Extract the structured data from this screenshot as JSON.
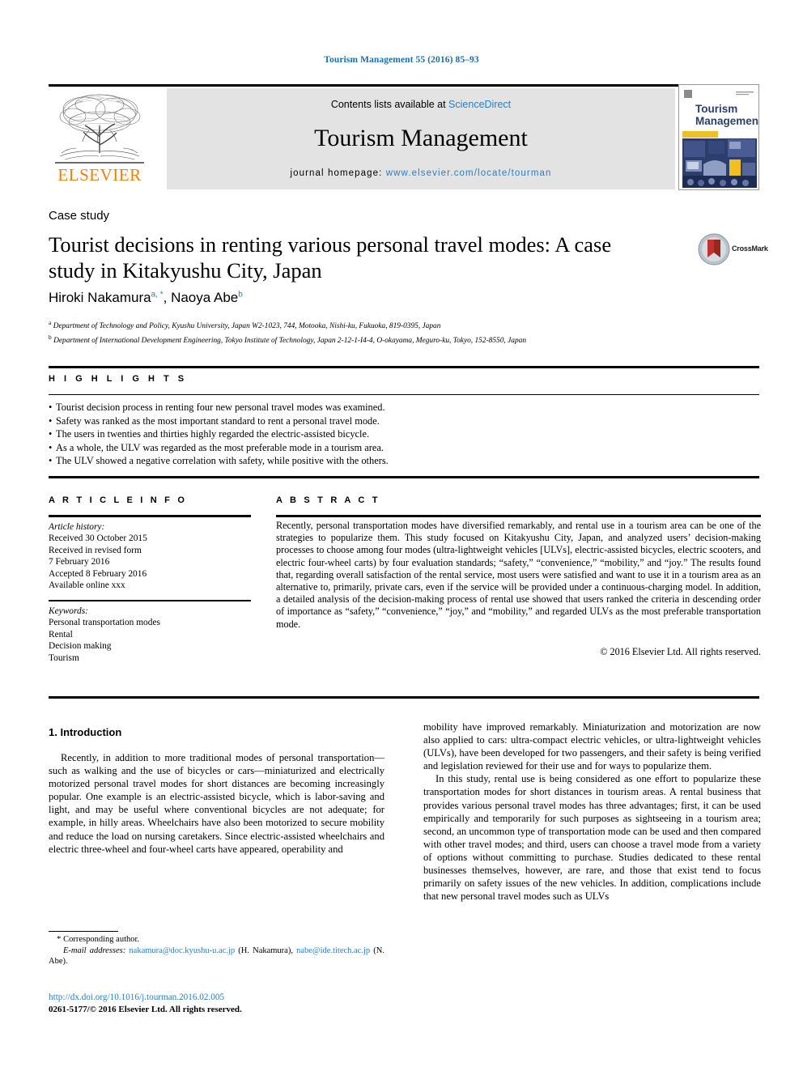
{
  "running_head": "Tourism Management 55 (2016) 85–93",
  "masthead": {
    "contents_prefix": "Contents lists available at ",
    "sciencedirect": "ScienceDirect",
    "journal_name": "Tourism Management",
    "homepage_label": "journal homepage: ",
    "homepage_url": "www.elsevier.com/locate/tourman",
    "publisher_logo_text": "ELSEVIER",
    "cover_title_line1": "Tourism",
    "cover_title_line2": "Management"
  },
  "colors": {
    "link": "#2a7fc0",
    "running_head": "#1d6fa5",
    "elsevier_orange": "#f08000",
    "band_gray": "#e3e3e3",
    "cover_navy": "#2c3e6b",
    "cover_yellow": "#f0c020"
  },
  "article": {
    "type_label": "Case study",
    "title": "Tourist decisions in renting various personal travel modes: A case study in Kitakyushu City, Japan",
    "authors_html": "Hiroki Nakamura, Naoya Abe",
    "author1_name": "Hiroki Nakamura",
    "author1_marks": "a, *",
    "author2_name": "Naoya Abe",
    "author2_marks": "b",
    "affiliation_a_mark": "a",
    "affiliation_a": "Department of Technology and Policy, Kyushu University, Japan W2-1023, 744, Motooka, Nishi-ku, Fukuoka, 819-0395, Japan",
    "affiliation_b_mark": "b",
    "affiliation_b": "Department of International Development Engineering, Tokyo Institute of Technology, Japan 2-12-1-I4-4, O-okayama, Meguro-ku, Tokyo, 152-8550, Japan",
    "crossmark_label": "CrossMark"
  },
  "highlights": {
    "heading": "H I G H L I G H T S",
    "items": [
      "Tourist decision process in renting four new personal travel modes was examined.",
      "Safety was ranked as the most important standard to rent a personal travel mode.",
      "The users in twenties and thirties highly regarded the electric-assisted bicycle.",
      "As a whole, the ULV was regarded as the most preferable mode in a tourism area.",
      "The ULV showed a negative correlation with safety, while positive with the others."
    ]
  },
  "article_info": {
    "heading": "A R T I C L E  I N F O",
    "history_label": "Article history:",
    "history_lines": [
      "Received 30 October 2015",
      "Received in revised form",
      "7 February 2016",
      "Accepted 8 February 2016",
      "Available online xxx"
    ],
    "keywords_label": "Keywords:",
    "keywords": [
      "Personal transportation modes",
      "Rental",
      "Decision making",
      "Tourism"
    ]
  },
  "abstract": {
    "heading": "A B S T R A C T",
    "text": "Recently, personal transportation modes have diversified remarkably, and rental use in a tourism area can be one of the strategies to popularize them. This study focused on Kitakyushu City, Japan, and analyzed users’ decision-making processes to choose among four modes (ultra-lightweight vehicles [ULVs], electric-assisted bicycles, electric scooters, and electric four-wheel carts) by four evaluation standards; “safety,” “convenience,” “mobility,” and “joy.” The results found that, regarding overall satisfaction of the rental service, most users were satisfied and want to use it in a tourism area as an alternative to, primarily, private cars, even if the service will be provided under a continuous-charging model. In addition, a detailed analysis of the decision-making process of rental use showed that users ranked the criteria in descending order of importance as “safety,” “convenience,” “joy,” and “mobility,” and regarded ULVs as the most preferable transportation mode.",
    "copyright": "© 2016 Elsevier Ltd. All rights reserved."
  },
  "body": {
    "section_number_title": "1. Introduction",
    "left_paragraph_1": "Recently, in addition to more traditional modes of personal transportation—such as walking and the use of bicycles or cars—miniaturized and electrically motorized personal travel modes for short distances are becoming increasingly popular. One example is an electric-assisted bicycle, which is labor-saving and light, and may be useful where conventional bicycles are not adequate; for example, in hilly areas. Wheelchairs have also been motorized to secure mobility and reduce the load on nursing caretakers. Since electric-assisted wheelchairs and electric three-wheel and four-wheel carts have appeared, operability and",
    "right_paragraph_1": "mobility have improved remarkably. Miniaturization and motorization are now also applied to cars: ultra-compact electric vehicles, or ultra-lightweight vehicles (ULVs), have been developed for two passengers, and their safety is being verified and legislation reviewed for their use and for ways to popularize them.",
    "right_paragraph_2": "In this study, rental use is being considered as one effort to popularize these transportation modes for short distances in tourism areas. A rental business that provides various personal travel modes has three advantages; first, it can be used empirically and temporarily for such purposes as sightseeing in a tourism area; second, an uncommon type of transportation mode can be used and then compared with other travel modes; and third, users can choose a travel mode from a variety of options without committing to purchase. Studies dedicated to these rental businesses themselves, however, are rare, and those that exist tend to focus primarily on safety issues of the new vehicles. In addition, complications include that new personal travel modes such as ULVs"
  },
  "footer": {
    "corresponding_marker": "*",
    "corresponding_label": "Corresponding author.",
    "email_label": "E-mail addresses:",
    "email1": "nakamura@doc.kyushu-u.ac.jp",
    "email1_owner": "(H. Nakamura)",
    "email2": "nabe@ide.titech.ac.jp",
    "email2_owner": "(N. Abe).",
    "doi_url": "http://dx.doi.org/10.1016/j.tourman.2016.02.005",
    "issn_line": "0261-5177/© 2016 Elsevier Ltd. All rights reserved."
  }
}
